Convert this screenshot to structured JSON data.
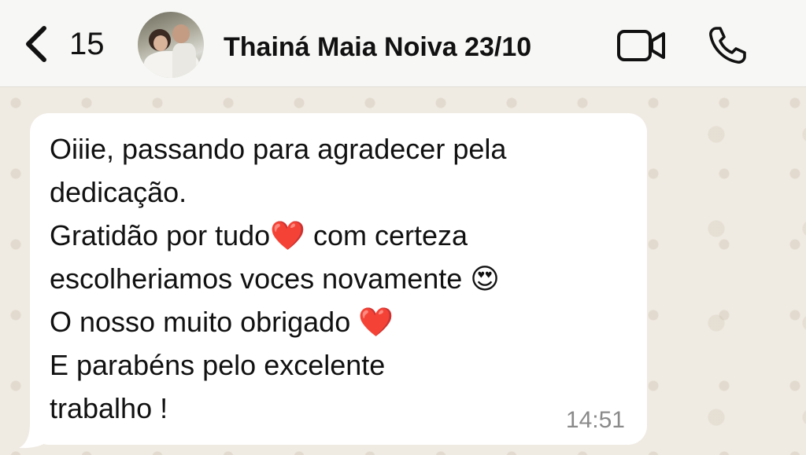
{
  "header": {
    "back_count": "15",
    "contact_name": "Thainá Maia Noiva 23/10"
  },
  "message": {
    "lines": [
      "Oiiie, passando para agradecer pela",
      "dedicação.",
      "Gratidão por tudo❤️ com certeza",
      "escolheriamos voces novamente 😍",
      "O nosso muito obrigado ❤️",
      "E parabéns pelo excelente",
      "trabalho !"
    ],
    "time": "14:51"
  },
  "icons": {
    "back": "chevron-left-icon",
    "video": "video-camera-icon",
    "call": "phone-icon"
  },
  "colors": {
    "header_bg": "#f7f7f5",
    "chat_bg": "#efeae2",
    "bubble_bg": "#ffffff",
    "time_text": "#8a8a8a"
  }
}
